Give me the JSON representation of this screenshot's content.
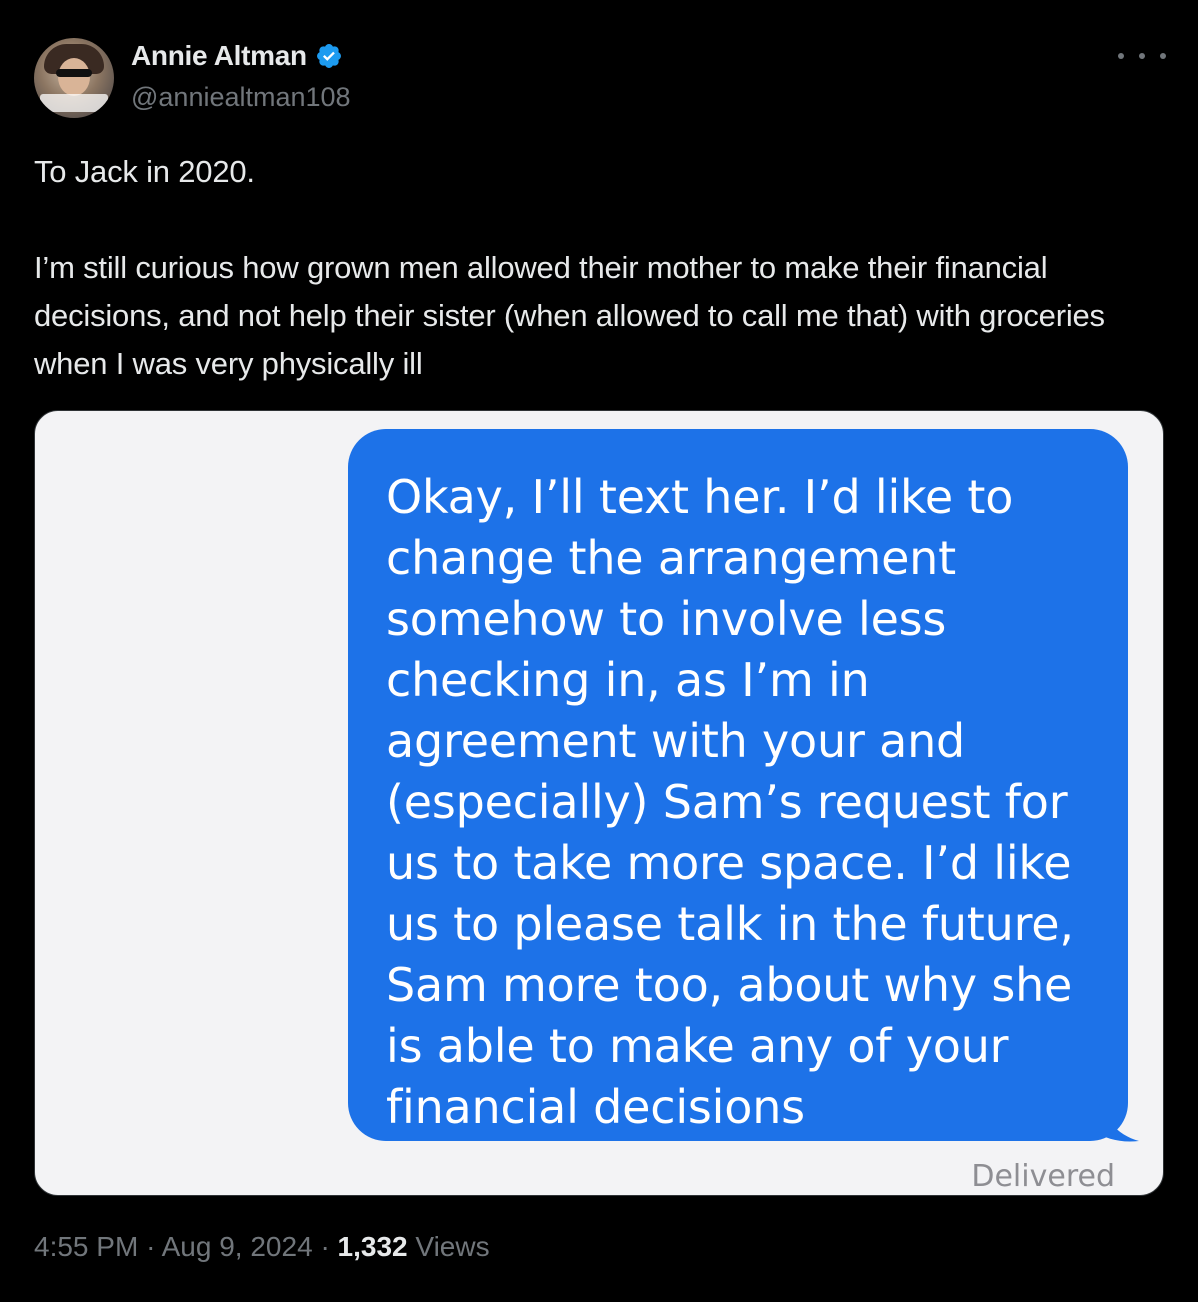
{
  "author": {
    "name": "Annie Altman",
    "handle": "@anniealtman108",
    "verified": true,
    "verified_color": "#1d9bf0"
  },
  "tweet": {
    "paragraphs": [
      "To Jack in 2020.",
      "I’m still curious how grown men allowed their mother to make their financial decisions, and not help their sister (when allowed to call me that) with groceries when I was very physically ill"
    ]
  },
  "media": {
    "message_text": "Okay, I’ll text her. I’d like to change the arrangement somehow to involve less checking in, as I’m in agreement with your and (especially) Sam’s request for us to take more space. I’d like us to please talk in the future, Sam more too, about why she is able to make any of your financial decisions",
    "bubble_color": "#1d72e8",
    "status": "Delivered"
  },
  "meta": {
    "time": "4:55 PM",
    "separator": "·",
    "date": "Aug 9, 2024",
    "views_count": "1,332",
    "views_label": "Views"
  },
  "icons": {
    "more": "more-icon",
    "verified": "verified-badge-icon"
  }
}
